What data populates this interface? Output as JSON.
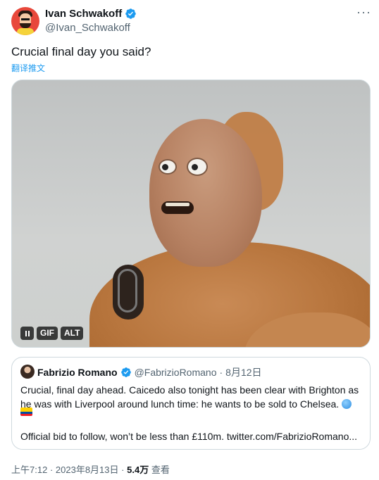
{
  "tweet": {
    "author": {
      "display_name": "Ivan Schwakoff",
      "handle": "@Ivan_Schwakoff",
      "verified_icon": "verified-badge-icon"
    },
    "more_icon": "more-dots-icon",
    "text": "Crucial final day you said?",
    "translate_label": "翻译推文",
    "media": {
      "type_label": "GIF",
      "alt_label": "ALT",
      "pause_icon": "pause-icon"
    },
    "quoted": {
      "display_name": "Fabrizio Romano",
      "handle": "@FabrizioRomano",
      "separator": "·",
      "date": "8月12日",
      "text": "Crucial, final day ahead. Caicedo also tonight has been clear with Brighton as he was with Liverpool around lunch time: he wants to be sold to Chelsea.",
      "text2": "Official bid to follow, won’t be less than £110m. twitter.com/FabrizioRomano..."
    },
    "meta": {
      "time": "上午7:12",
      "separator": "·",
      "date": "2023年8月13日",
      "views_count": "5.4万",
      "views_label": "查看"
    },
    "colors": {
      "accent": "#1d9bf0",
      "secondary_text": "#536471",
      "border": "#cfd9de"
    }
  }
}
